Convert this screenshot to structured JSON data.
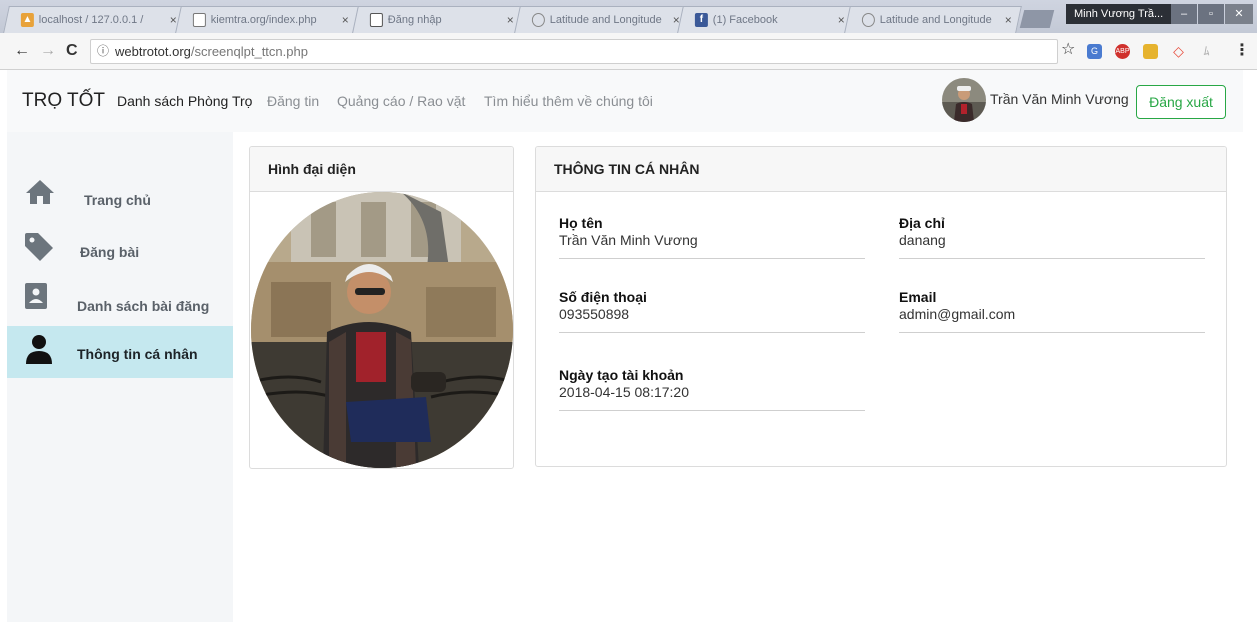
{
  "browser": {
    "tabs": [
      {
        "title": "localhost / 127.0.0.1 / ",
        "icon": "phpmyadmin-icon"
      },
      {
        "title": "kiemtra.org/index.php",
        "icon": "page-icon"
      },
      {
        "title": "Đăng nhập",
        "icon": "page-icon",
        "active": true
      },
      {
        "title": "Latitude and Longitude",
        "icon": "globe-icon"
      },
      {
        "title": "(1) Facebook",
        "icon": "facebook-icon"
      },
      {
        "title": "Latitude and Longitude",
        "icon": "globe-icon"
      }
    ],
    "tab_close": "×",
    "window_user": "Minh Vương Trầ...",
    "url_host": "webtrotot.org",
    "url_path": "/screenqlpt_ttcn.php"
  },
  "navbar": {
    "brand": "TRỌ TỐT",
    "links": [
      "Danh sách Phòng Trọ",
      "Đăng tin",
      "Quảng cáo / Rao vặt",
      "Tìm hiểu thêm về chúng tôi"
    ],
    "user_name": "Trần Văn Minh Vương",
    "logout_label": "Đăng xuất"
  },
  "sidebar": {
    "items": [
      {
        "label": "Trang chủ",
        "icon": "home-icon"
      },
      {
        "label": "Đăng bài",
        "icon": "tag-icon"
      },
      {
        "label": "Danh sách bài đăng",
        "icon": "contact-card-icon"
      },
      {
        "label": "Thông tin cá nhân",
        "icon": "user-icon",
        "active": true
      }
    ]
  },
  "avatar_card": {
    "title": "Hình đại diện"
  },
  "profile": {
    "title": "THÔNG TIN CÁ NHÂN",
    "fields": [
      {
        "label": "Họ tên",
        "value": "Trần Văn Minh Vương"
      },
      {
        "label": "Địa chỉ",
        "value": "danang"
      },
      {
        "label": "Số điện thoại",
        "value": "093550898"
      },
      {
        "label": "Email",
        "value": "admin@gmail.com"
      },
      {
        "label": "Ngày tạo tài khoản",
        "value": "2018-04-15 08:17:20"
      }
    ]
  },
  "colors": {
    "accent_green": "#28a745",
    "sidebar_active": "#c5e8ef",
    "sidebar_bg": "#f4f6f8"
  }
}
